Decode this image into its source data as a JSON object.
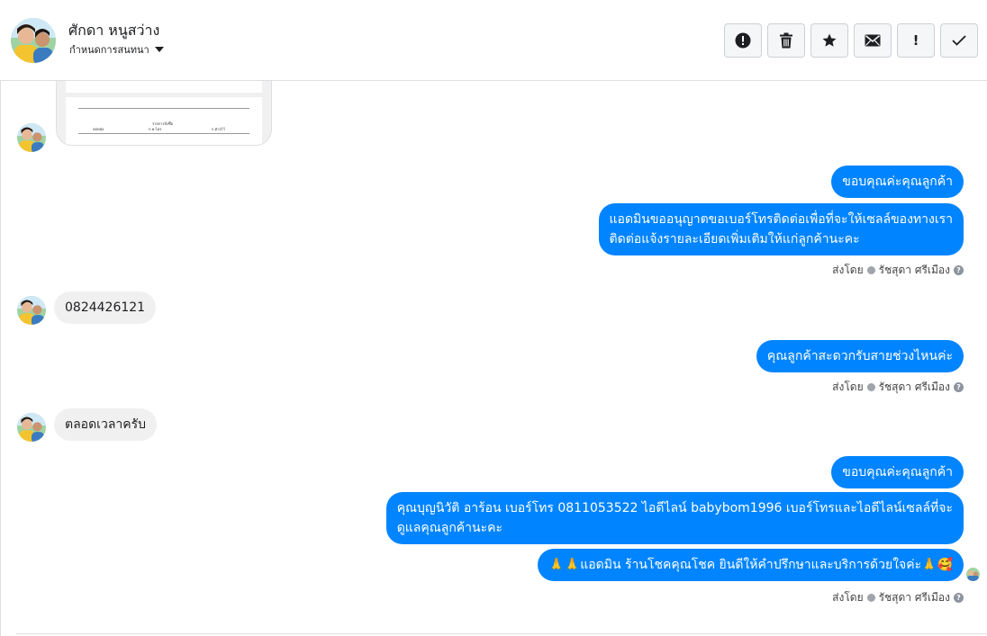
{
  "header": {
    "contact_name": "ศักดา หนูสว่าง",
    "assign_label": "กำหนดการสนทนา",
    "toolbar": [
      {
        "icon": "alert-circle-icon"
      },
      {
        "icon": "trash-icon"
      },
      {
        "icon": "star-icon"
      },
      {
        "icon": "envelope-icon"
      },
      {
        "icon": "exclamation-icon",
        "label": "!"
      },
      {
        "icon": "checkmark-icon"
      }
    ]
  },
  "messages": {
    "m1": "ขอบคุณค่ะคุณลูกค้า",
    "m2_line1": "แอดมินขออนุญาตขอเบอร์โทรติดต่อเพื่อที่จะให้เซลล์ของทางเรา",
    "m2_line2": "ติดต่อแจ้งรายละเอียดเพิ่มเติมให้แก่ลูกค้านะคะ",
    "m3": "0824426121",
    "m4": "คุณลูกค้าสะดวกรับสายช่วงไหนค่ะ",
    "m5": "ตลอดเวลาครับ",
    "m6": "ขอบคุณค่ะคุณลูกค้า",
    "m7_line1": "คุณบุญนิวัติ  อาร้อน        เบอร์โทร 0811053522  ไอดีไลน์ babybom1996   เบอร์โทรและไอดีไลน์เซลล์ที่จะ",
    "m7_line2": "ดูแลคุณลูกค้านะคะ",
    "m8": "🙏🙏แอดมิน ร้านโชคคุณโชค ยินดีให้คำปรึกษาและบริการด้วยใจค่ะ🙏🥰"
  },
  "sent_by": {
    "prefix": "ส่งโดย",
    "agent": "รัชสุดา ศรีเมือง"
  },
  "attachment_preview": {
    "text_title": "รายการสั่งซื้อ",
    "text_a": "ลดหนัง",
    "text_b": "ก.ค.ไม่ร",
    "text_c": "ก.ต่างไว้"
  },
  "colors": {
    "outgoing_bubble": "#0084ff",
    "incoming_bubble": "#f1f0f0",
    "border": "#dddfe2"
  }
}
